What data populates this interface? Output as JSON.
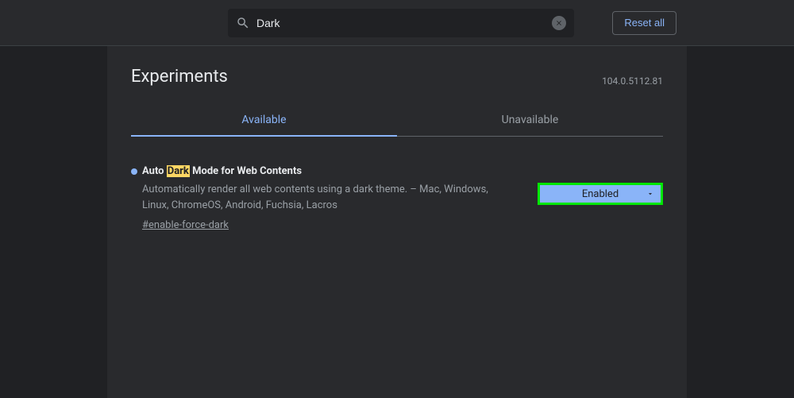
{
  "header": {
    "search_value": "Dark",
    "reset_label": "Reset all"
  },
  "page": {
    "title": "Experiments",
    "version": "104.0.5112.81"
  },
  "tabs": {
    "available": "Available",
    "unavailable": "Unavailable"
  },
  "flag": {
    "title_pre": "Auto ",
    "title_highlight": "Dark",
    "title_post": " Mode for Web Contents",
    "description": "Automatically render all web contents using a dark theme. – Mac, Windows, Linux, ChromeOS, Android, Fuchsia, Lacros",
    "link": "#enable-force-dark",
    "selected": "Enabled"
  }
}
